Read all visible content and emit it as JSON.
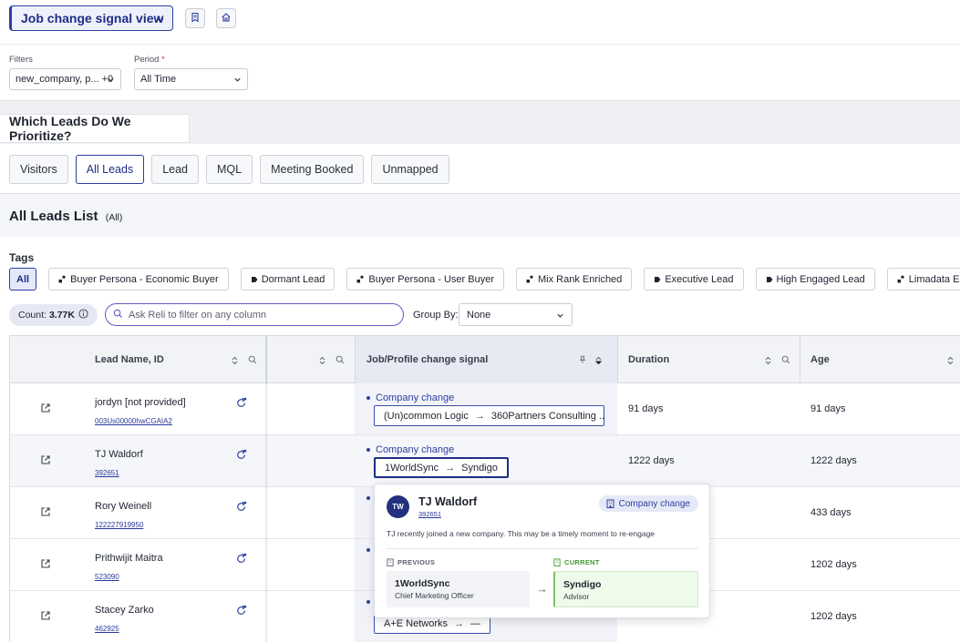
{
  "header": {
    "view_title": "Job change signal view",
    "icons": [
      "chevron-down-icon",
      "bookmark-icon",
      "home-icon"
    ]
  },
  "filters": {
    "filters_label": "Filters",
    "filters_value": "new_company, p... +0",
    "period_label": "Period",
    "period_required_mark": "*",
    "period_value": "All Time"
  },
  "section": {
    "title": "Which Leads Do We Prioritize?"
  },
  "tabs": [
    "Visitors",
    "All Leads",
    "Lead",
    "MQL",
    "Meeting Booked",
    "Unmapped"
  ],
  "active_tab": "All Leads",
  "list": {
    "title": "All Leads List",
    "scope": "(All)"
  },
  "tags": {
    "label": "Tags",
    "items": [
      "All",
      "Buyer Persona - Economic Buyer",
      "Dormant Lead",
      "Buyer Persona - User Buyer",
      "Mix Rank Enriched",
      "Executive Lead",
      "High Engaged Lead",
      "Limadata Enriched"
    ]
  },
  "toolbar": {
    "count_label": "Count:",
    "count_value": "3.77K",
    "search_placeholder": "Ask Reli to filter on any column",
    "group_by_label": "Group By:",
    "group_by_value": "None"
  },
  "table": {
    "columns": {
      "lead_name": "Lead Name, ID",
      "signal": "Job/Profile change signal",
      "duration": "Duration",
      "age": "Age"
    },
    "rows": [
      {
        "name": "jordyn [not provided]",
        "id": "003Us00000hwCGAIA2",
        "signal_type": "Company change",
        "from": "(Un)common Logic",
        "to": "360Partners Consulting ...",
        "duration": "91 days",
        "age": "91 days"
      },
      {
        "name": "TJ Waldorf",
        "id": "392651",
        "signal_type": "Company change",
        "from": "1WorldSync",
        "to": "Syndigo",
        "duration": "1222 days",
        "age": "1222 days"
      },
      {
        "name": "Rory Weinell",
        "id": "122227919950",
        "signal_type": "",
        "from": "",
        "to": "",
        "duration": "",
        "age": "433 days"
      },
      {
        "name": "Prithwijit Maitra",
        "id": "523090",
        "signal_type": "",
        "from": "",
        "to": "",
        "duration": "",
        "age": "1202 days"
      },
      {
        "name": "Stacey Zarko",
        "id": "462925",
        "signal_type": "",
        "from": "A+E Networks",
        "to": "—",
        "duration": "",
        "age": "1202 days"
      }
    ]
  },
  "popover": {
    "initials": "TW",
    "name": "TJ Waldorf",
    "id": "392651",
    "badge": "Company change",
    "description": "TJ recently joined a new company. This may be a timely moment to re-engage",
    "previous_label": "PREVIOUS",
    "current_label": "CURRENT",
    "previous_company": "1WorldSync",
    "previous_role": "Chief Marketing Officer",
    "current_company": "Syndigo",
    "current_role": "Advisor"
  },
  "colors": {
    "accent": "#2c3fa0",
    "accent_dark": "#1e2d86",
    "current_green": "#3f9a2e",
    "reli_purple": "#6e55c7"
  }
}
